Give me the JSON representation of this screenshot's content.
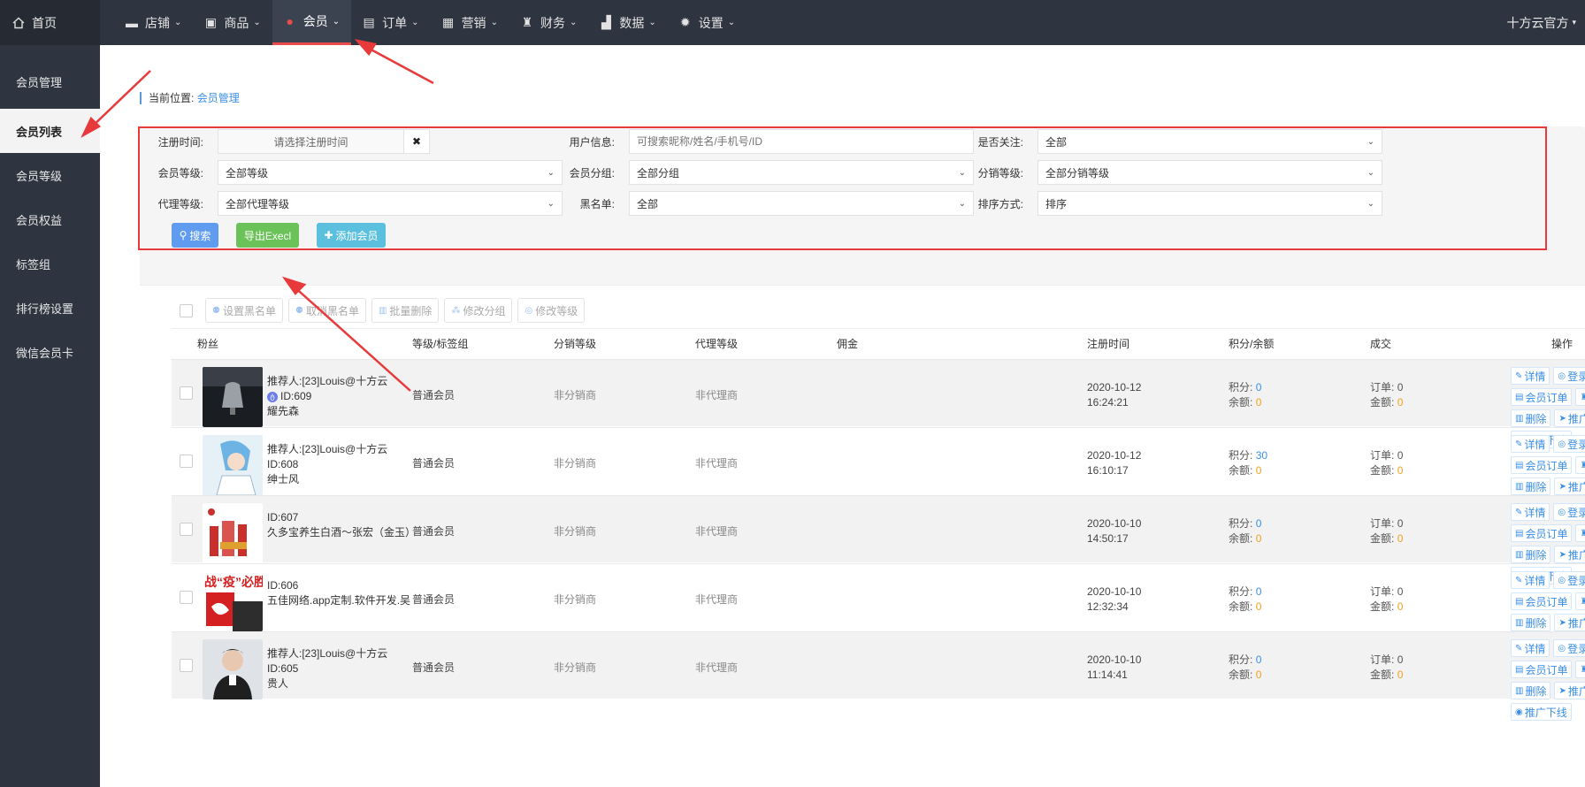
{
  "topbar": {
    "home": "首页",
    "menu": [
      {
        "label": "店铺",
        "icon": "store-icon"
      },
      {
        "label": "商品",
        "icon": "goods-icon"
      },
      {
        "label": "会员",
        "icon": "user-icon"
      },
      {
        "label": "订单",
        "icon": "order-icon"
      },
      {
        "label": "营销",
        "icon": "gift-icon"
      },
      {
        "label": "财务",
        "icon": "money-bag-icon"
      },
      {
        "label": "数据",
        "icon": "bar-chart-icon"
      },
      {
        "label": "设置",
        "icon": "gear-icon"
      }
    ],
    "active_index": 2,
    "account": "十方云官方"
  },
  "sidebar": {
    "items": [
      "会员管理",
      "会员列表",
      "会员等级",
      "会员权益",
      "标签组",
      "排行榜设置",
      "微信会员卡"
    ],
    "active_index": 1
  },
  "breadcrumb": {
    "prefix": "当前位置:",
    "link": "会员管理"
  },
  "filters": {
    "reg_time_label": "注册时间:",
    "reg_time_placeholder": "请选择注册时间",
    "clear_symbol": "✖",
    "user_info_label": "用户信息:",
    "user_info_placeholder": "可搜索昵称/姓名/手机号/ID",
    "follow_label": "是否关注:",
    "follow_value": "全部",
    "member_level_label": "会员等级:",
    "member_level_value": "全部等级",
    "member_group_label": "会员分组:",
    "member_group_value": "全部分组",
    "dist_level_label": "分销等级:",
    "dist_level_value": "全部分销等级",
    "agent_level_label": "代理等级:",
    "agent_level_value": "全部代理等级",
    "blacklist_label": "黑名单:",
    "blacklist_value": "全部",
    "sort_label": "排序方式:",
    "sort_value": "排序"
  },
  "actions": {
    "search": "搜索",
    "export": "导出Execl",
    "add": "添加会员"
  },
  "toolbar": [
    "设置黑名单",
    "取消黑名单",
    "批量删除",
    "修改分组",
    "修改等级"
  ],
  "columns": [
    "粉丝",
    "等级/标签组",
    "分销等级",
    "代理等级",
    "佣金",
    "注册时间",
    "积分/余额",
    "成交",
    "操作"
  ],
  "rows": [
    {
      "referrer": "推荐人:[23]Louis@十方云",
      "id": "ID:609",
      "name": "耀先森",
      "has_badge": true,
      "level": "普通会员",
      "dist": "非分销商",
      "agent": "非代理商",
      "date": "2020-10-12",
      "time": "16:24:21",
      "points_label": "积分:",
      "points": "0",
      "balance_label": "余额:",
      "balance": "0",
      "orders_label": "订单:",
      "orders": "0",
      "amount_label": "金额:",
      "amount": "0"
    },
    {
      "referrer": "推荐人:[23]Louis@十方云",
      "id": "ID:608",
      "name": "绅士风",
      "has_badge": false,
      "level": "普通会员",
      "dist": "非分销商",
      "agent": "非代理商",
      "date": "2020-10-12",
      "time": "16:10:17",
      "points_label": "积分:",
      "points": "30",
      "balance_label": "余额:",
      "balance": "0",
      "orders_label": "订单:",
      "orders": "0",
      "amount_label": "金额:",
      "amount": "0"
    },
    {
      "referrer": "",
      "id": "ID:607",
      "name": "久多宝养生白酒～张宏（金玉）",
      "has_badge": false,
      "level": "普通会员",
      "dist": "非分销商",
      "agent": "非代理商",
      "date": "2020-10-10",
      "time": "14:50:17",
      "points_label": "积分:",
      "points": "0",
      "balance_label": "余额:",
      "balance": "0",
      "orders_label": "订单:",
      "orders": "0",
      "amount_label": "金额:",
      "amount": "0"
    },
    {
      "referrer": "",
      "id": "ID:606",
      "name": "五佳网络.app定制.软件开发.吴",
      "has_badge": false,
      "level": "普通会员",
      "dist": "非分销商",
      "agent": "非代理商",
      "date": "2020-10-10",
      "time": "12:32:34",
      "points_label": "积分:",
      "points": "0",
      "balance_label": "余额:",
      "balance": "0",
      "orders_label": "订单:",
      "orders": "0",
      "amount_label": "金额:",
      "amount": "0"
    },
    {
      "referrer": "推荐人:[23]Louis@十方云",
      "id": "ID:605",
      "name": "贵人",
      "has_badge": false,
      "level": "普通会员",
      "dist": "非分销商",
      "agent": "非代理商",
      "date": "2020-10-10",
      "time": "11:14:41",
      "points_label": "积分:",
      "points": "0",
      "balance_label": "余额:",
      "balance": "0",
      "orders_label": "订单:",
      "orders": "0",
      "amount_label": "金额:",
      "amount": "0"
    }
  ],
  "row_ops": [
    "详情",
    "登录",
    "会员订单",
    "充值",
    "删除",
    "推广订单",
    "推广下线"
  ],
  "avatar_texts": [
    "战“疫”必胜"
  ],
  "colors": {
    "nav_bg": "#2f3540",
    "accent_red": "#e8393b",
    "link_blue": "#3a8ee6",
    "orange": "#f0a020"
  }
}
